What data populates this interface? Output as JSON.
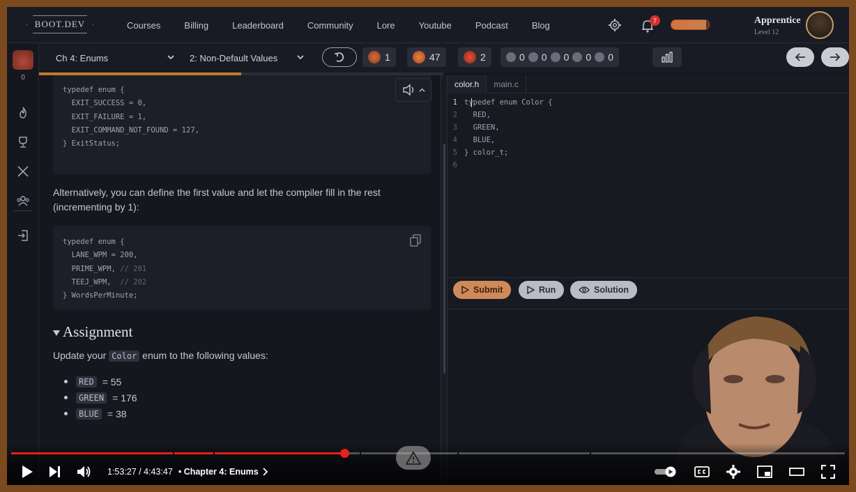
{
  "nav": {
    "logo": "BOOT.DEV",
    "links": [
      "Courses",
      "Billing",
      "Leaderboard",
      "Community",
      "Lore",
      "Youtube",
      "Podcast",
      "Blog"
    ],
    "notifications": "7",
    "user_rank": "Apprentice",
    "user_level": "Level 12",
    "xp_progress": 0.92
  },
  "rail": {
    "pet_count": "0"
  },
  "toolbar": {
    "chapter": "Ch 4: Enums",
    "lesson": "2: Non-Default Values",
    "stats": {
      "streak": "1",
      "gems": "47",
      "armor": "2",
      "potions": "0",
      "shields": "0",
      "seals": "0",
      "stones": "0",
      "flames": "0"
    },
    "lesson_progress": 0.5
  },
  "lesson": {
    "code1": [
      "typedef enum {",
      "  EXIT_SUCCESS = 0,",
      "  EXIT_FAILURE = 1,",
      "  EXIT_COMMAND_NOT_FOUND = 127,",
      "} ExitStatus;"
    ],
    "paragraph": "Alternatively, you can define the first value and let the compiler fill in the rest (incrementing by 1):",
    "code2": {
      "l1": "typedef enum {",
      "l2": "  LANE_WPM = 200,",
      "l3a": "  PRIME_WPM, ",
      "l3b": "// 201",
      "l4a": "  TEEJ_WPM,  ",
      "l4b": "// 202",
      "l5": "} WordsPerMinute;"
    },
    "assignment_heading": "Assignment",
    "assignment_pre": "Update your ",
    "assignment_code": "Color",
    "assignment_post": " enum to the following values:",
    "items": [
      {
        "name": "RED",
        "value": " = 55"
      },
      {
        "name": "GREEN",
        "value": " = 176"
      },
      {
        "name": "BLUE",
        "value": " = 38"
      }
    ]
  },
  "editor": {
    "tabs": [
      "color.h",
      "main.c"
    ],
    "lines": [
      "typedef enum Color {",
      "  RED,",
      "  GREEN,",
      "  BLUE,",
      "} color_t;",
      ""
    ],
    "line_numbers": [
      "1",
      "2",
      "3",
      "4",
      "5",
      "6"
    ]
  },
  "actions": {
    "submit": "Submit",
    "run": "Run",
    "solution": "Solution"
  },
  "video": {
    "time": "1:53:27 / 4:43:47",
    "chapter": "• Chapter 4: Enums",
    "progress": 0.4
  }
}
